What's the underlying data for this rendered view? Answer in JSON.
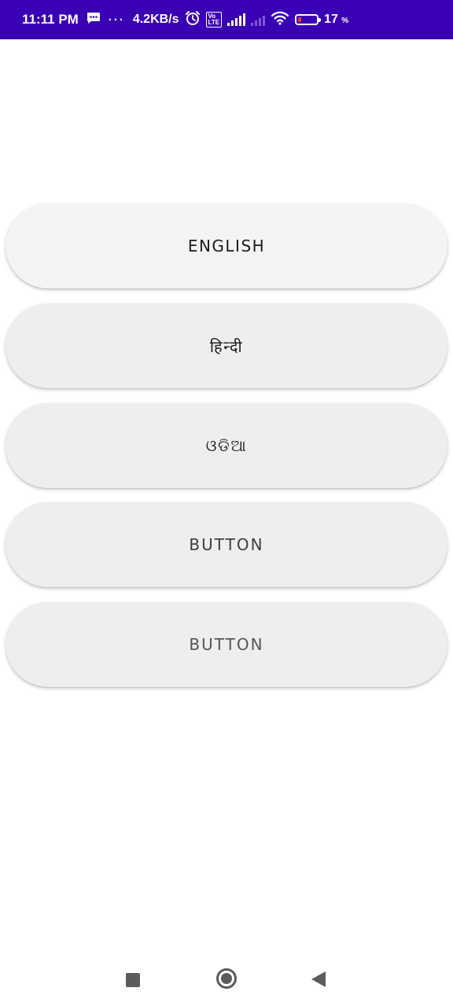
{
  "status_bar": {
    "time": "11:11 PM",
    "message_icon": "sms-notification-icon",
    "more_dots": "···",
    "net_speed": "4.2KB/s",
    "alarm_icon": "alarm-icon",
    "volte": "Vo\nLTE",
    "wifi_icon": "wifi-icon",
    "battery_percent": "17",
    "battery_unit": "%",
    "battery_level": 0.17,
    "background_color": "#3a00b4"
  },
  "buttons": {
    "english": "ENGLISH",
    "hindi": "हिन्दी",
    "odia": "ଓଡିଆ",
    "button4": "BUTTON",
    "button5": "BUTTON"
  },
  "nav_bar": {
    "recents_icon": "square-recents-icon",
    "home_icon": "circle-home-icon",
    "back_icon": "triangle-back-icon"
  }
}
